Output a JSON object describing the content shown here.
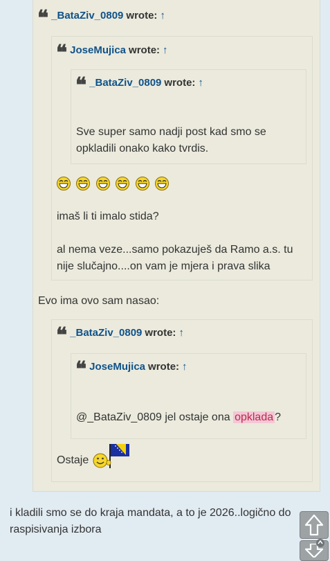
{
  "quote1": {
    "author": "_BataZiv_0809",
    "wrote": "wrote:",
    "arrow": "↑"
  },
  "quote2": {
    "author": "JoseMujica",
    "wrote": "wrote:",
    "arrow": "↑"
  },
  "quote3": {
    "author": "_BataZiv_0809",
    "wrote": "wrote:",
    "arrow": "↑",
    "line1": "Sve super samo nadji post kad smo se",
    "line2": "opkladili onako kako tvrdis."
  },
  "quote2_body": {
    "smiley_count": 6,
    "line1": "imaš li ti imalo stida?",
    "line2": "al nema veze...samo pokazuješ da Ramo a.s. tu",
    "line3": "nije slučajno....on vam je mjera i prava slika"
  },
  "quote1_body": {
    "line1": "Evo ima ovo sam nasao:"
  },
  "quote4": {
    "author": "_BataZiv_0809",
    "wrote": "wrote:",
    "arrow": "↑",
    "ostaje": "Ostaje"
  },
  "quote5": {
    "author": "JoseMujica",
    "wrote": "wrote:",
    "arrow": "↑",
    "text_before": "@_BataZiv_0809 jel ostaje ona ",
    "highlight": "opklada",
    "text_after": "?"
  },
  "post": {
    "line1": "i kladili smo se do kraja mandata, a to je 2026..logično do",
    "line2": "raspisivanja izbora"
  },
  "colors": {
    "link": "#105289",
    "quote_bg": "#ebeadd",
    "page_bg": "#e1ebf2",
    "highlight": "#f3c7d6"
  },
  "icons": [
    "quote-icon",
    "laughing-smiley-icon",
    "flag-smiley-icon",
    "scroll-up-icon",
    "scroll-down-icon"
  ]
}
